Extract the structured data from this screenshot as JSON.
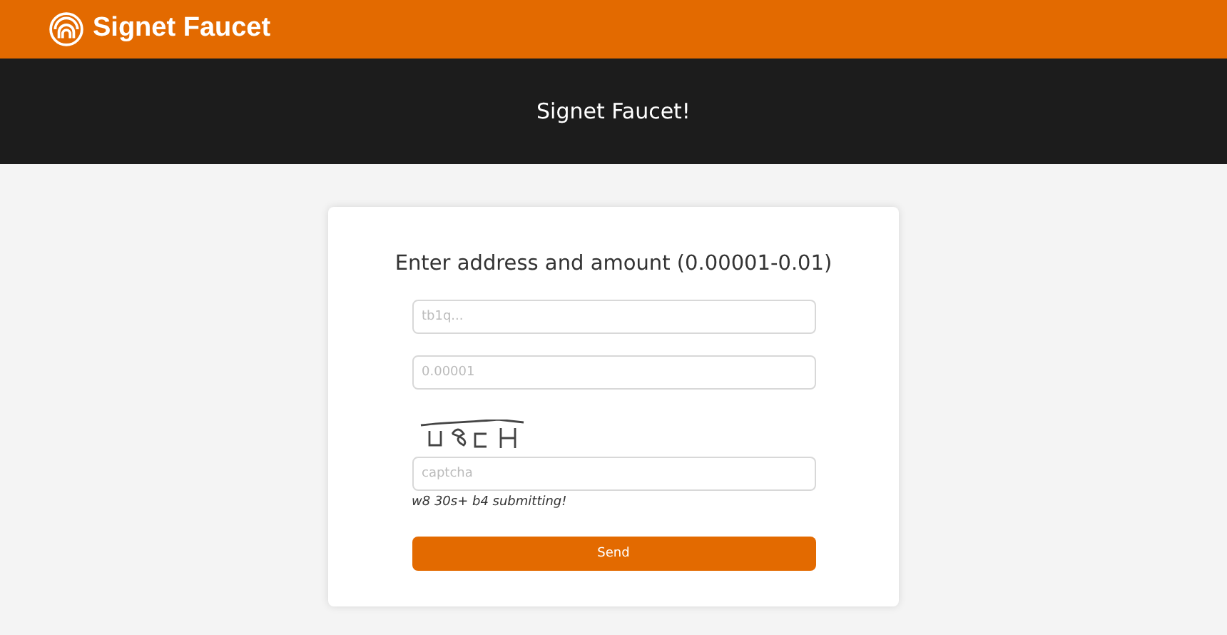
{
  "navbar": {
    "brand": "Signet Faucet"
  },
  "banner": {
    "title": "Signet Faucet!"
  },
  "form": {
    "heading": "Enter address and amount (0.00001-0.01)",
    "fields": [
      {
        "placeholder": "tb1q..."
      },
      {
        "placeholder": "0.00001"
      }
    ],
    "captcha_field": {
      "placeholder": "captcha"
    },
    "note": "w8 30s+ b4 submitting!",
    "button": "Send"
  }
}
